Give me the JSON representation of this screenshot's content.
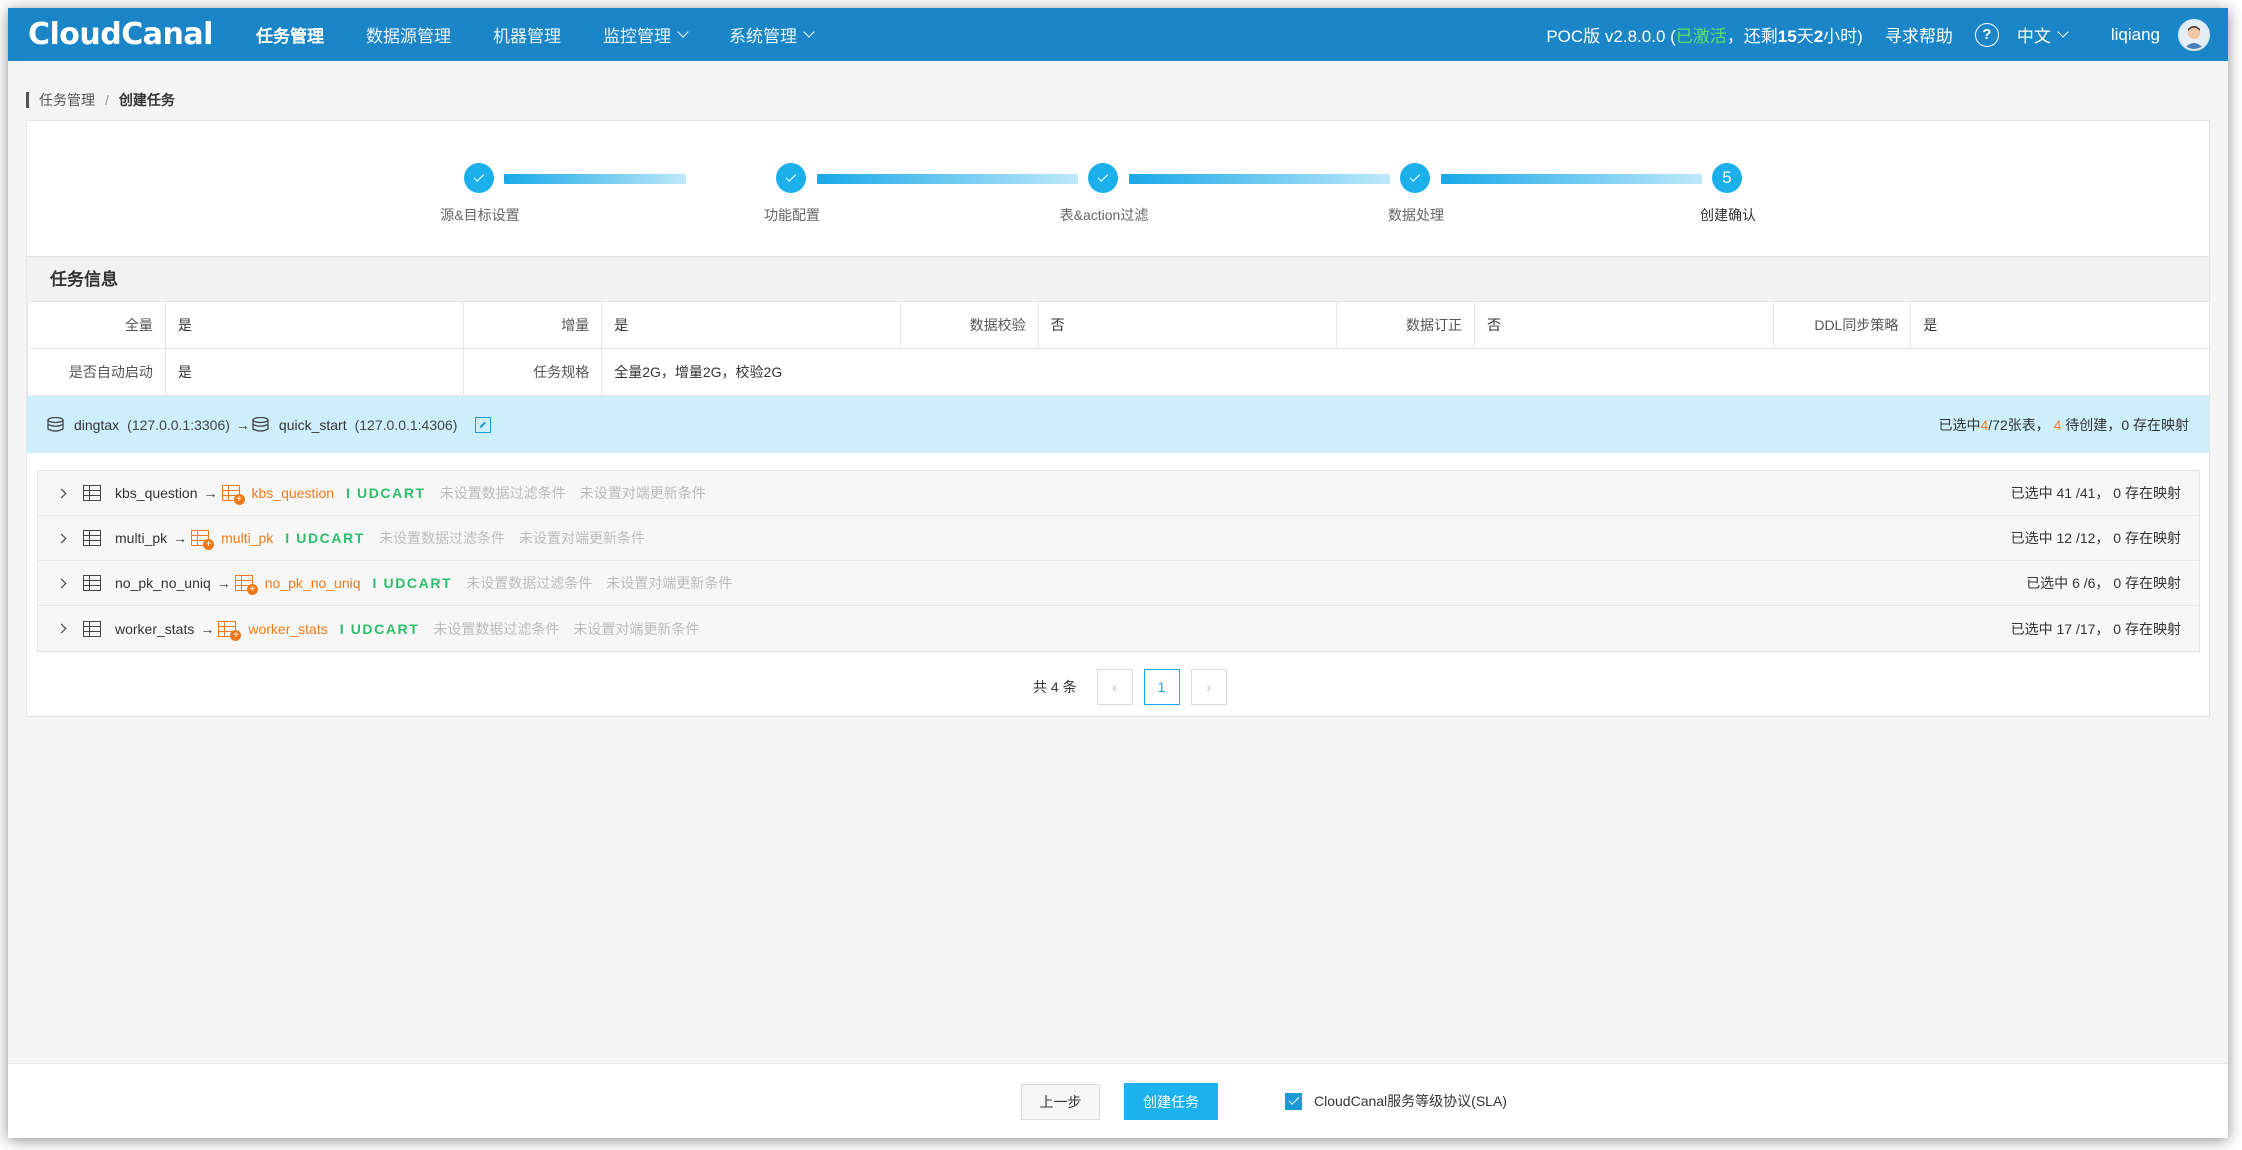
{
  "app": {
    "logo": "CloudCanal",
    "nav": [
      "任务管理",
      "数据源管理",
      "机器管理",
      "监控管理",
      "系统管理"
    ],
    "version_prefix": "POC版 v2.8.0.0  (",
    "version_status": "已激活",
    "version_mid": "，还剩",
    "version_days": "15",
    "version_days_unit": "天",
    "version_hours": "2",
    "version_suffix": "小时)",
    "help": "寻求帮助",
    "help_icon": "?",
    "language": "中文",
    "user": "liqiang"
  },
  "breadcrumb": {
    "parent": "任务管理",
    "sep": "/",
    "current": "创建任务"
  },
  "steps": [
    {
      "label": "源&目标设置",
      "done": true
    },
    {
      "label": "功能配置",
      "done": true
    },
    {
      "label": "表&action过滤",
      "done": true
    },
    {
      "label": "数据处理",
      "done": true
    },
    {
      "label": "创建确认",
      "number": "5",
      "done": false
    }
  ],
  "task_info": {
    "title": "任务信息",
    "row1": [
      {
        "key": "全量",
        "value": "是"
      },
      {
        "key": "增量",
        "value": "是"
      },
      {
        "key": "数据校验",
        "value": "否"
      },
      {
        "key": "数据订正",
        "value": "否"
      },
      {
        "key": "DDL同步策略",
        "value": "是"
      }
    ],
    "row2": [
      {
        "key": "是否自动启动",
        "value": "是"
      },
      {
        "key": "任务规格",
        "value": "全量2G，增量2G，校验2G"
      }
    ]
  },
  "db_mapping": {
    "source_name": "dingtax",
    "source_addr": "(127.0.0.1:3306)",
    "arrow": "→",
    "target_name": "quick_start",
    "target_addr": "(127.0.0.1:4306)",
    "summary_prefix": "已选中",
    "summary_selected": "4",
    "summary_total": "/72张表，",
    "summary_pending": "4",
    "summary_pending_text": " 待创建，",
    "summary_mapped": "0 存在映射"
  },
  "tables": [
    {
      "source": "kbs_question",
      "target": "kbs_question",
      "actions": "I UDCART",
      "filter_hint": "未设置数据过滤条件",
      "update_hint": "未设置对端更新条件",
      "stat": "已选中 41 /41， 0 存在映射"
    },
    {
      "source": "multi_pk",
      "target": "multi_pk",
      "actions": "I UDCART",
      "filter_hint": "未设置数据过滤条件",
      "update_hint": "未设置对端更新条件",
      "stat": "已选中 12 /12， 0 存在映射"
    },
    {
      "source": "no_pk_no_uniq",
      "target": "no_pk_no_uniq",
      "actions": "I UDCART",
      "filter_hint": "未设置数据过滤条件",
      "update_hint": "未设置对端更新条件",
      "stat": "已选中 6 /6， 0 存在映射"
    },
    {
      "source": "worker_stats",
      "target": "worker_stats",
      "actions": "I UDCART",
      "filter_hint": "未设置数据过滤条件",
      "update_hint": "未设置对端更新条件",
      "stat": "已选中 17 /17， 0 存在映射"
    }
  ],
  "pagination": {
    "total": "共 4 条",
    "prev": "‹",
    "current": "1",
    "next": "›"
  },
  "footer": {
    "prev_label": "上一步",
    "create_label": "创建任务",
    "sla_label": "CloudCanal服务等级协议(SLA)",
    "sla_checked": true
  },
  "colors": {
    "header": "#1a86c7",
    "accent": "#1cb2ef",
    "orange": "#f07a1a",
    "green": "#2bbf6a"
  }
}
